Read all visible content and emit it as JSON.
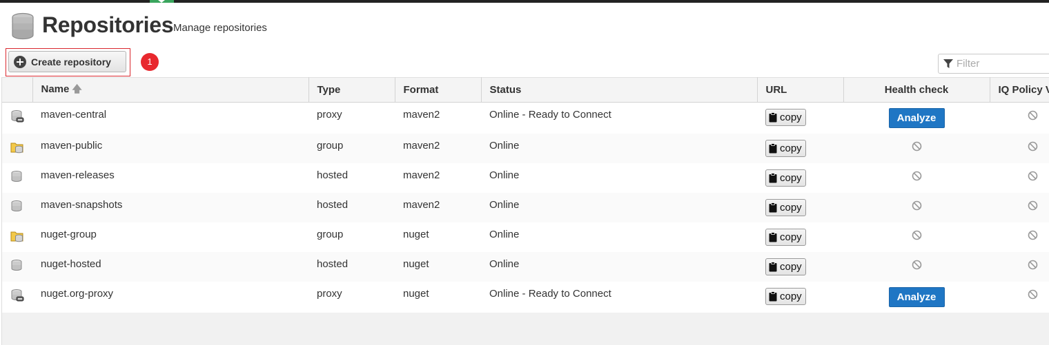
{
  "header": {
    "title": "Repositories",
    "subtitle": "Manage repositories"
  },
  "toolbar": {
    "create_label": "Create repository",
    "badge": "1",
    "filter_placeholder": "Filter"
  },
  "columns": [
    "Name",
    "Type",
    "Format",
    "Status",
    "URL",
    "Health check",
    "IQ Policy Violations"
  ],
  "rows": [
    {
      "icon": "proxy-repo-icon",
      "name": "maven-central",
      "type": "proxy",
      "format": "maven2",
      "status": "Online - Ready to Connect",
      "url_button": "copy",
      "health": "Analyze",
      "iq": "unavailable"
    },
    {
      "icon": "group-repo-icon",
      "name": "maven-public",
      "type": "group",
      "format": "maven2",
      "status": "Online",
      "url_button": "copy",
      "health": "unavailable",
      "iq": "unavailable"
    },
    {
      "icon": "hosted-repo-icon",
      "name": "maven-releases",
      "type": "hosted",
      "format": "maven2",
      "status": "Online",
      "url_button": "copy",
      "health": "unavailable",
      "iq": "unavailable"
    },
    {
      "icon": "hosted-repo-icon",
      "name": "maven-snapshots",
      "type": "hosted",
      "format": "maven2",
      "status": "Online",
      "url_button": "copy",
      "health": "unavailable",
      "iq": "unavailable"
    },
    {
      "icon": "group-repo-icon",
      "name": "nuget-group",
      "type": "group",
      "format": "nuget",
      "status": "Online",
      "url_button": "copy",
      "health": "unavailable",
      "iq": "unavailable"
    },
    {
      "icon": "hosted-repo-icon",
      "name": "nuget-hosted",
      "type": "hosted",
      "format": "nuget",
      "status": "Online",
      "url_button": "copy",
      "health": "unavailable",
      "iq": "unavailable"
    },
    {
      "icon": "proxy-repo-icon",
      "name": "nuget.org-proxy",
      "type": "proxy",
      "format": "nuget",
      "status": "Online - Ready to Connect",
      "url_button": "copy",
      "health": "Analyze",
      "iq": "unavailable"
    }
  ],
  "colors": {
    "analyze": "#1f76c4",
    "badge": "#e8282e",
    "highlight": "#d9262d",
    "topbar_tab": "#3aa55d"
  }
}
